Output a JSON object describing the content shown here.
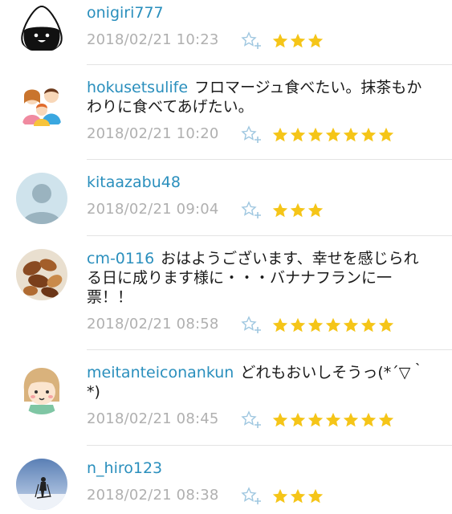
{
  "comments": [
    {
      "username": "onigiri777",
      "text": "",
      "date": "2018/02/21 10:23",
      "rating": 3,
      "avatar_icon": "onigiri-icon"
    },
    {
      "username": "hokusetsulife",
      "text": "フロマージュ食べたい。抹茶もかわりに食べてあげたい。",
      "date": "2018/02/21 10:20",
      "rating": 7,
      "avatar_icon": "family-icon"
    },
    {
      "username": "kitaazabu48",
      "text": "",
      "date": "2018/02/21 09:04",
      "rating": 3,
      "avatar_icon": "default-user-icon"
    },
    {
      "username": "cm-0116",
      "text": "おはようございます、幸せを感じられる日に成ります様に・・・バナナフランに一票！！",
      "date": "2018/02/21 08:58",
      "rating": 7,
      "avatar_icon": "nuts-photo-icon"
    },
    {
      "username": "meitanteiconankun",
      "text": "どれもおいしそうっ(*´▽｀*)",
      "date": "2018/02/21 08:45",
      "rating": 7,
      "avatar_icon": "girl-face-icon"
    },
    {
      "username": "n_hiro123",
      "text": "",
      "date": "2018/02/21 08:38",
      "rating": 3,
      "avatar_icon": "skier-photo-icon"
    }
  ],
  "colors": {
    "username": "#2a8fbd",
    "star": "#f5c518",
    "date": "#b0b0b0",
    "add_star": "#9fc7e0"
  }
}
